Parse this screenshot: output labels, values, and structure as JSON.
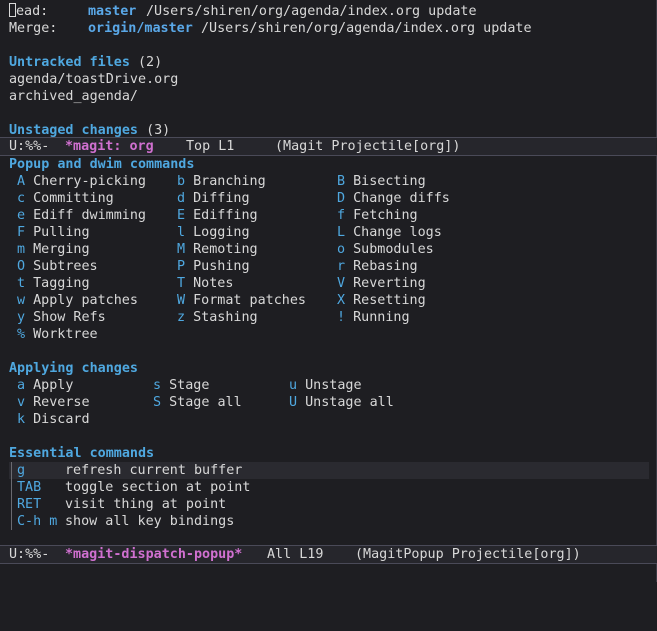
{
  "status": {
    "head_label": "ead:",
    "head_branch": "master",
    "head_path": "/Users/shiren/org/agenda/index.org update",
    "merge_label": "Merge:",
    "merge_branch": "origin/master",
    "merge_path": "/Users/shiren/org/agenda/index.org update"
  },
  "untracked": {
    "title": "Untracked files",
    "count": "(2)",
    "files": [
      "agenda/toastDrive.org",
      "archived_agenda/"
    ]
  },
  "unstaged": {
    "title": "Unstaged changes",
    "count": "(3)"
  },
  "modeline_top": {
    "state": "U:%%-",
    "buffer": "*magit: org",
    "position": "Top L1",
    "modes": "(Magit Projectile[org])"
  },
  "popup": {
    "title": "Popup and dwim commands",
    "col1": [
      {
        "key": "A",
        "label": "Cherry-picking"
      },
      {
        "key": "c",
        "label": "Committing"
      },
      {
        "key": "e",
        "label": "Ediff dwimming"
      },
      {
        "key": "F",
        "label": "Pulling"
      },
      {
        "key": "m",
        "label": "Merging"
      },
      {
        "key": "O",
        "label": "Subtrees"
      },
      {
        "key": "t",
        "label": "Tagging"
      },
      {
        "key": "w",
        "label": "Apply patches"
      },
      {
        "key": "y",
        "label": "Show Refs"
      },
      {
        "key": "%",
        "label": "Worktree"
      }
    ],
    "col2": [
      {
        "key": "b",
        "label": "Branching"
      },
      {
        "key": "d",
        "label": "Diffing"
      },
      {
        "key": "E",
        "label": "Ediffing"
      },
      {
        "key": "l",
        "label": "Logging"
      },
      {
        "key": "M",
        "label": "Remoting"
      },
      {
        "key": "P",
        "label": "Pushing"
      },
      {
        "key": "T",
        "label": "Notes"
      },
      {
        "key": "W",
        "label": "Format patches"
      },
      {
        "key": "z",
        "label": "Stashing"
      }
    ],
    "col3": [
      {
        "key": "B",
        "label": "Bisecting"
      },
      {
        "key": "D",
        "label": "Change diffs"
      },
      {
        "key": "f",
        "label": "Fetching"
      },
      {
        "key": "L",
        "label": "Change logs"
      },
      {
        "key": "o",
        "label": "Submodules"
      },
      {
        "key": "r",
        "label": "Rebasing"
      },
      {
        "key": "V",
        "label": "Reverting"
      },
      {
        "key": "X",
        "label": "Resetting"
      },
      {
        "key": "!",
        "label": "Running"
      }
    ]
  },
  "applying": {
    "title": "Applying changes",
    "col1": [
      {
        "key": "a",
        "label": "Apply"
      },
      {
        "key": "v",
        "label": "Reverse"
      },
      {
        "key": "k",
        "label": "Discard"
      }
    ],
    "col2": [
      {
        "key": "s",
        "label": "Stage"
      },
      {
        "key": "S",
        "label": "Stage all"
      }
    ],
    "col3": [
      {
        "key": "u",
        "label": "Unstage"
      },
      {
        "key": "U",
        "label": "Unstage all"
      }
    ]
  },
  "essential": {
    "title": "Essential commands",
    "items": [
      {
        "key": "g",
        "label": "refresh current buffer"
      },
      {
        "key": "TAB",
        "label": "toggle section at point"
      },
      {
        "key": "RET",
        "label": "visit thing at point"
      },
      {
        "key": "C-h m",
        "label": "show all key bindings"
      }
    ]
  },
  "modeline_bottom": {
    "state": "U:%%-",
    "buffer": "*magit-dispatch-popup*",
    "position": "All L19",
    "modes": "(MagitPopup Projectile[org])"
  }
}
